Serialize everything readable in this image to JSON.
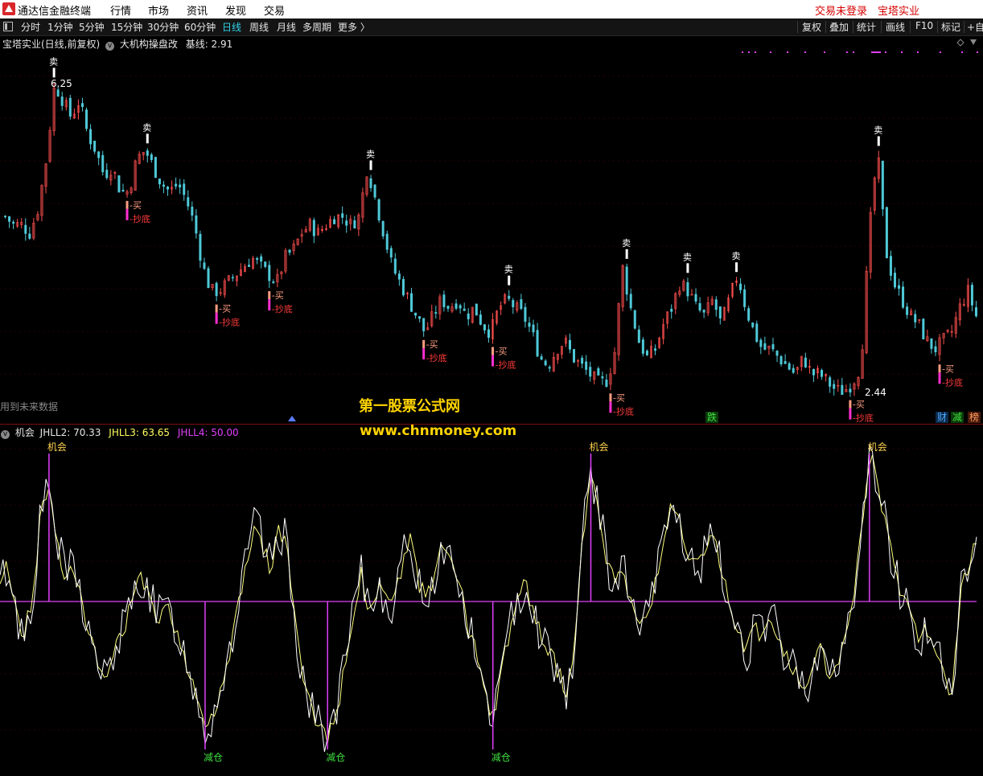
{
  "window": {
    "app_title": "通达信金融终端",
    "menu": [
      "行情",
      "市场",
      "资讯",
      "发现",
      "交易"
    ],
    "status_login": "交易未登录",
    "status_stock": "宝塔实业"
  },
  "toolbar": {
    "periods": [
      "分时",
      "1分钟",
      "5分钟",
      "15分钟",
      "30分钟",
      "60分钟",
      "日线",
      "周线",
      "月线",
      "多周期",
      "更多 〉"
    ],
    "active_period": "日线",
    "tools": [
      "复权",
      "叠加",
      "统计",
      "画线",
      "F10",
      "标记",
      "+自"
    ]
  },
  "main_chart": {
    "stock_label": "宝塔实业(日线,前复权)",
    "indicator_label": "大机构操盘改",
    "base_label": "基线: 2.91",
    "high_label": "6.25",
    "low_label": "2.44",
    "future_data_label": "用到未来数据",
    "bottom_markers": [
      "跌",
      "财",
      "减",
      "榜"
    ]
  },
  "sub_chart": {
    "indicator": "机会",
    "jhll2": "JHLL2: 70.33",
    "jhll3": "JHLL3: 63.65",
    "jhll4": "JHLL4: 50.00"
  },
  "watermark": {
    "line1": "第一股票公式网",
    "line2": "www.chnmoney.com"
  },
  "chart_data": [
    {
      "type": "candlestick",
      "title": "宝塔实业(日线,前复权)",
      "indicator": "大机构操盘改",
      "baseline": 2.91,
      "x_approx_days": 240,
      "y_range_approx": [
        2.4,
        6.3
      ],
      "annotated_high": 6.25,
      "annotated_low": 2.44,
      "close_path_approx": [
        4.6,
        4.5,
        4.5,
        4.4,
        4.7,
        5.3,
        6.2,
        6.0,
        5.8,
        6.0,
        5.6,
        5.4,
        5.1,
        5.2,
        4.9,
        4.9,
        5.3,
        5.4,
        5.2,
        5.0,
        4.9,
        5.0,
        4.8,
        4.5,
        4.0,
        3.7,
        3.7,
        3.8,
        3.9,
        4.0,
        4.1,
        4.0,
        3.9,
        3.8,
        4.1,
        4.2,
        4.4,
        4.5,
        4.4,
        4.5,
        4.6,
        4.6,
        4.5,
        4.6,
        5.2,
        4.8,
        4.4,
        4.0,
        3.8,
        3.6,
        3.4,
        3.2,
        3.4,
        3.6,
        3.5,
        3.6,
        3.4,
        3.5,
        3.3,
        3.2,
        3.5,
        3.6,
        3.5,
        3.4,
        3.2,
        2.9,
        2.8,
        3.0,
        3.1,
        2.9,
        2.8,
        2.7,
        2.6,
        2.6,
        2.9,
        4.0,
        3.5,
        3.1,
        2.9,
        3.0,
        3.3,
        3.5,
        3.8,
        3.7,
        3.5,
        3.4,
        3.6,
        3.3,
        3.6,
        3.9,
        3.5,
        3.2,
        3.0,
        3.0,
        2.9,
        2.8,
        2.7,
        2.9,
        2.7,
        2.7,
        2.6,
        2.5,
        2.5,
        2.6,
        2.8,
        4.4,
        5.4,
        4.2,
        3.8,
        3.6,
        3.4,
        3.3,
        3.1,
        3.0,
        3.1,
        3.2,
        3.5,
        3.7,
        3.4
      ],
      "signals": {
        "sell": [
          "卖"
        ],
        "buy": [
          "买"
        ],
        "bottom": [
          "抄底"
        ]
      },
      "bottom_markers": [
        "跌",
        "财",
        "减",
        "榜"
      ]
    },
    {
      "type": "line",
      "title": "机会",
      "series": [
        {
          "name": "JHLL2",
          "last_value": 70.33,
          "color": "#ffffff"
        },
        {
          "name": "JHLL3",
          "last_value": 63.65,
          "color": "#ffff80"
        },
        {
          "name": "JHLL4",
          "last_value": 50.0,
          "color": "#e040fb"
        }
      ],
      "y_range_approx": [
        0,
        100
      ],
      "baseline": 50,
      "osc_path_approx": [
        55,
        62,
        45,
        40,
        52,
        78,
        85,
        68,
        58,
        62,
        50,
        38,
        30,
        25,
        35,
        42,
        48,
        58,
        55,
        45,
        48,
        45,
        38,
        28,
        22,
        10,
        15,
        25,
        35,
        48,
        62,
        75,
        68,
        60,
        72,
        68,
        42,
        25,
        15,
        12,
        8,
        15,
        30,
        45,
        58,
        48,
        55,
        52,
        48,
        62,
        70,
        55,
        52,
        58,
        68,
        62,
        55,
        42,
        35,
        20,
        15,
        25,
        40,
        52,
        55,
        48,
        38,
        35,
        28,
        22,
        35,
        70,
        92,
        78,
        62,
        55,
        60,
        48,
        42,
        45,
        58,
        72,
        80,
        72,
        62,
        60,
        65,
        70,
        58,
        48,
        40,
        35,
        42,
        38,
        45,
        38,
        32,
        28,
        22,
        30,
        38,
        25,
        28,
        38,
        52,
        72,
        95,
        88,
        72,
        60,
        52,
        45,
        38,
        42,
        35,
        28,
        18,
        52,
        60,
        70
      ],
      "signals": {
        "opportunity": [
          "机会"
        ],
        "reduce": [
          "减仓"
        ]
      }
    }
  ],
  "colors": {
    "background": "#000000",
    "up": "#ff4f4f",
    "down": "#4fc9d8",
    "sell_marker": "#ffffff",
    "buy_marker": "#ff9e80",
    "bottom_marker": "#ff2fd0",
    "opportunity": "#ffd54f",
    "reduce": "#3fe03f",
    "watermark": "#ffd400",
    "active_tab": "#2fd3e8",
    "status_red": "#d40000"
  }
}
